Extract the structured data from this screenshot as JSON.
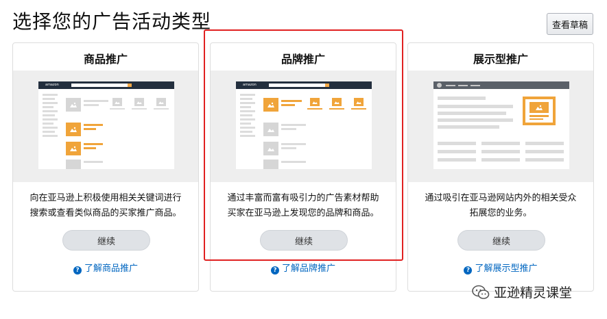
{
  "header": {
    "title": "选择您的广告活动类型",
    "draft_button": "查看草稿"
  },
  "cards": [
    {
      "title": "商品推广",
      "description_line1": "向在亚马逊上积极使用相关关键词进行",
      "description_line2": "搜索或查看类似商品的买家推广商品。",
      "button": "继续",
      "learn_link": "了解商品推广"
    },
    {
      "title": "品牌推广",
      "description_line1": "通过丰富而富有吸引力的广告素材帮助",
      "description_line2": "买家在亚马逊上发现您的品牌和商品。",
      "button": "继续",
      "learn_link": "了解品牌推广"
    },
    {
      "title": "展示型推广",
      "description_line1": "通过吸引在亚马逊网站内外的相关受众",
      "description_line2": "拓展您的业务。",
      "button": "继续",
      "learn_link": "了解展示型推广"
    }
  ],
  "mock_logo": "amazon",
  "help_icon_glyph": "?",
  "watermark": "亚逊精灵课堂",
  "colors": {
    "accent_orange": "#f0a43a",
    "link_blue": "#0066c0",
    "highlight_red": "#e02020",
    "mock_header": "#232f3e"
  }
}
